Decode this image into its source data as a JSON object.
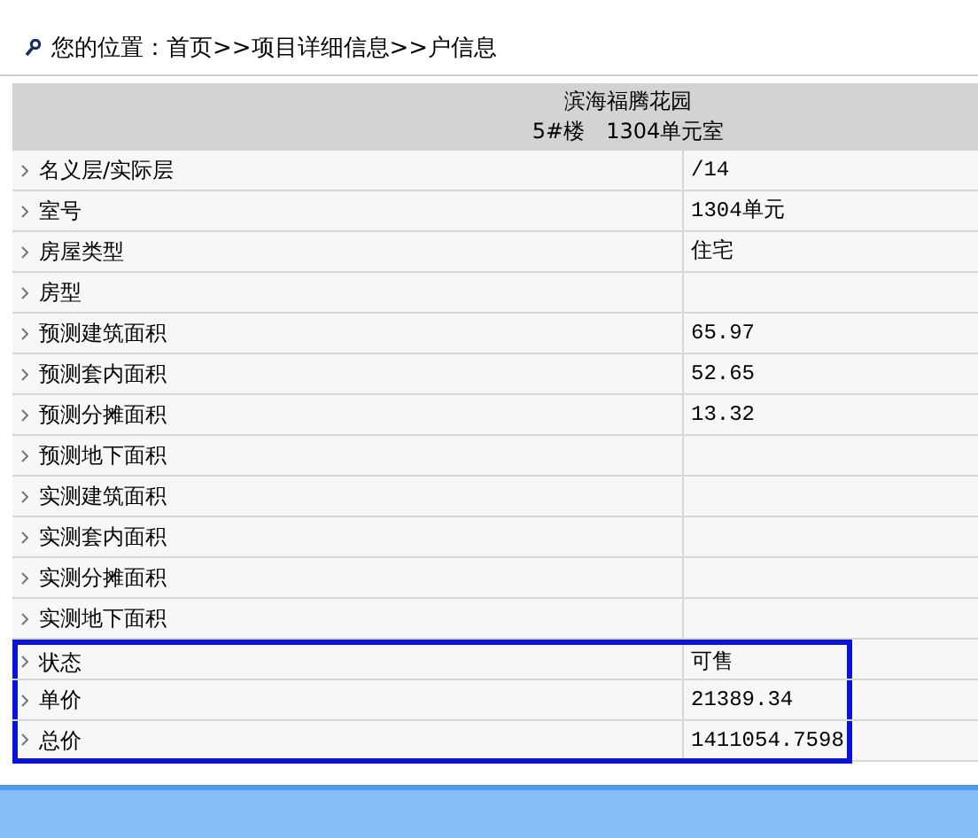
{
  "breadcrumb": "您的位置：首页>>项目详细信息>>户信息",
  "header": {
    "project": "滨海福腾花园",
    "unit": "5#楼　1304单元室"
  },
  "rows": [
    {
      "label": "名义层/实际层",
      "value": "/14",
      "highlighted": false
    },
    {
      "label": "室号",
      "value": "1304单元",
      "highlighted": false
    },
    {
      "label": "房屋类型",
      "value": "住宅",
      "highlighted": false
    },
    {
      "label": "房型",
      "value": "",
      "highlighted": false
    },
    {
      "label": "预测建筑面积",
      "value": "65.97",
      "highlighted": false
    },
    {
      "label": "预测套内面积",
      "value": "52.65",
      "highlighted": false
    },
    {
      "label": "预测分摊面积",
      "value": "13.32",
      "highlighted": false
    },
    {
      "label": "预测地下面积",
      "value": "",
      "highlighted": false
    },
    {
      "label": "实测建筑面积",
      "value": "",
      "highlighted": false
    },
    {
      "label": "实测套内面积",
      "value": "",
      "highlighted": false
    },
    {
      "label": "实测分摊面积",
      "value": "",
      "highlighted": false
    },
    {
      "label": "实测地下面积",
      "value": "",
      "highlighted": false
    },
    {
      "label": "状态",
      "value": "可售",
      "highlighted": true
    },
    {
      "label": "单价",
      "value": "21389.34",
      "highlighted": true
    },
    {
      "label": "总价",
      "value": "1411054.7598",
      "highlighted": true
    }
  ]
}
